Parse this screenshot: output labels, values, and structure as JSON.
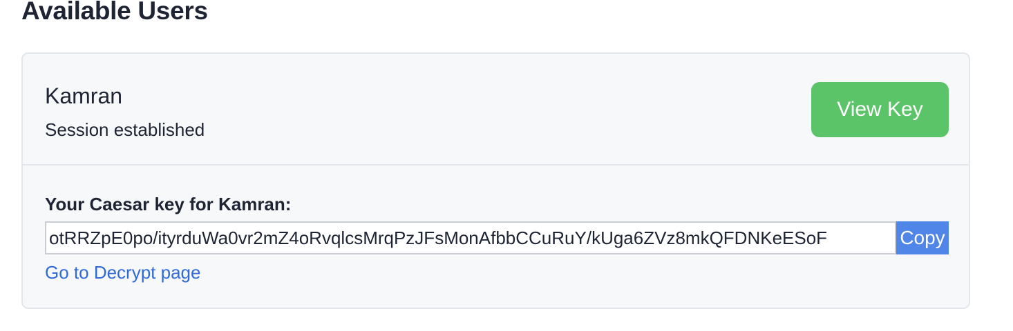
{
  "page": {
    "title": "Available Users"
  },
  "user_card": {
    "name": "Kamran",
    "status": "Session established",
    "view_key_label": "View Key",
    "key_label": "Your Caesar key for Kamran:",
    "key_value": "otRRZpE0po/ityrduWa0vr2mZ4oRvqlcsMrqPzJFsMonAfbbCCuRuY/kUga6ZVz8mkQFDNKeESoF",
    "copy_label": "Copy",
    "decrypt_link_label": "Go to Decrypt page"
  },
  "colors": {
    "accent_green": "#5cc468",
    "accent_blue": "#4f86e8",
    "link_blue": "#2f6ad6"
  }
}
